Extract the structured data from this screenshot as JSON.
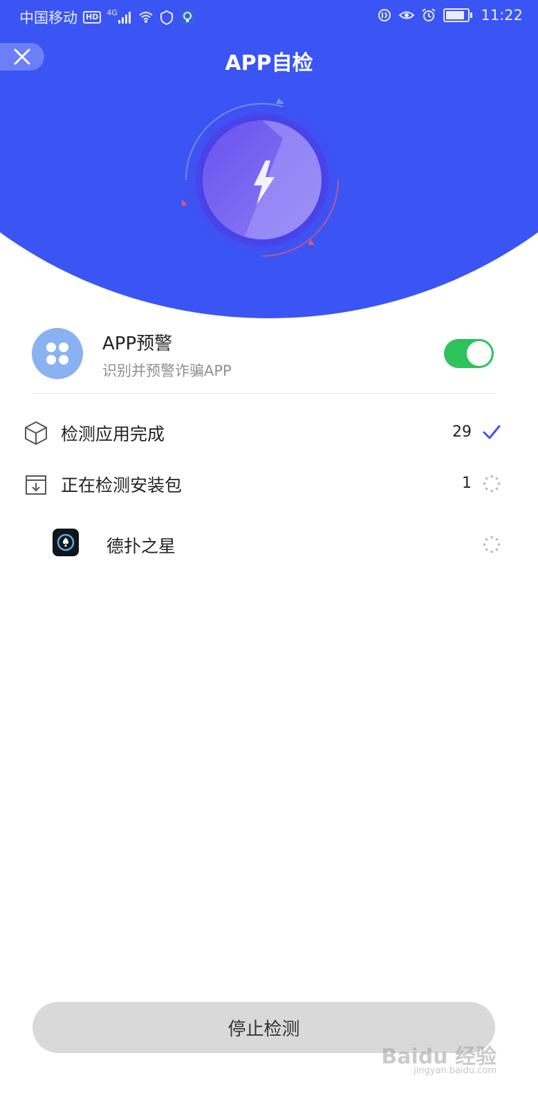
{
  "status_bar": {
    "carrier": "中国移动",
    "hd_badge": "HD",
    "network": "4G",
    "time": "11:22"
  },
  "header": {
    "title": "APP自检",
    "background_color": "#3a55f4"
  },
  "app_warning": {
    "title": "APP预警",
    "subtitle": "识别并预警诈骗APP",
    "toggle_on": true,
    "toggle_color": "#2dc25b"
  },
  "scan_list": [
    {
      "label": "检测应用完成",
      "count": "29",
      "icon": "box-icon",
      "status_icon": "checkmark-icon"
    },
    {
      "label": "正在检测安装包",
      "count": "1",
      "icon": "download-box-icon",
      "status_icon": "spinner-icon"
    }
  ],
  "scanning_app": {
    "name": "德扑之星",
    "status_icon": "spinner-icon"
  },
  "stop_button": {
    "label": "停止检测"
  },
  "watermark": {
    "text": "Baidu 经验",
    "sub": "jingyan.baidu.com"
  }
}
